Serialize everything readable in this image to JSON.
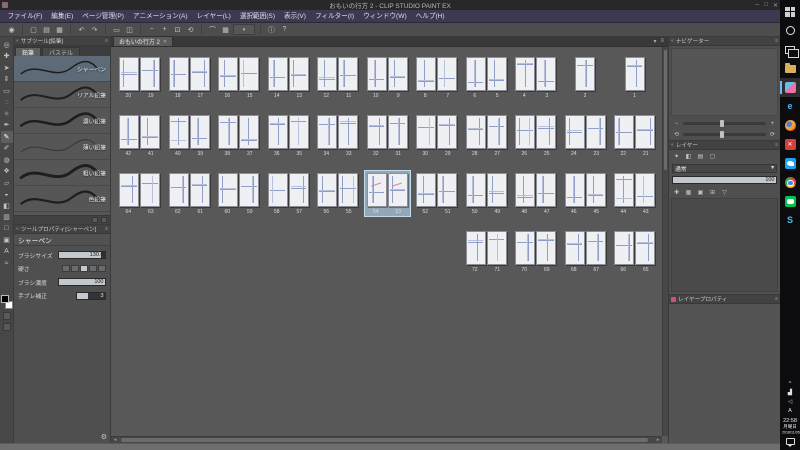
{
  "window": {
    "title": "おもいの行方 2 - CLIP STUDIO PAINT EX",
    "controls": [
      "─",
      "□",
      "✕"
    ]
  },
  "menu": {
    "items": [
      "ファイル(F)",
      "編集(E)",
      "ページ管理(P)",
      "アニメーション(A)",
      "レイヤー(L)",
      "選択範囲(S)",
      "表示(V)",
      "フィルター(I)",
      "ウィンドウ(W)",
      "ヘルプ(H)"
    ]
  },
  "command_bar": {
    "items": [
      {
        "name": "eye-icon",
        "glyph": "◉"
      },
      {
        "sep": true
      },
      {
        "name": "new-file-icon",
        "glyph": "▢"
      },
      {
        "name": "open-file-icon",
        "glyph": "▤"
      },
      {
        "name": "save-icon",
        "glyph": "▦"
      },
      {
        "sep": true
      },
      {
        "name": "undo-icon",
        "glyph": "↶"
      },
      {
        "name": "redo-icon",
        "glyph": "↷"
      },
      {
        "sep": true
      },
      {
        "name": "delete-icon",
        "glyph": "▭"
      },
      {
        "name": "deselect-icon",
        "glyph": "◫"
      },
      {
        "sep": true
      },
      {
        "name": "zoom-out-icon",
        "glyph": "−"
      },
      {
        "name": "zoom-in-icon",
        "glyph": "+"
      },
      {
        "name": "fit-view-icon",
        "glyph": "⊡"
      },
      {
        "name": "rotate-view-icon",
        "glyph": "⟲"
      },
      {
        "sep": true
      },
      {
        "name": "snap-ruler-icon",
        "glyph": "⌒"
      },
      {
        "name": "snap-grid-icon",
        "glyph": "▦"
      },
      {
        "name": "snap-mode-dropdown",
        "glyph": "▾",
        "wide": true
      },
      {
        "sep": true
      },
      {
        "name": "info-icon",
        "glyph": "ⓘ"
      },
      {
        "name": "help-icon",
        "glyph": "?"
      }
    ]
  },
  "tool_bar": {
    "tools": [
      {
        "name": "zoom-tool",
        "glyph": "◎"
      },
      {
        "name": "move-tool",
        "glyph": "✚"
      },
      {
        "name": "operation-tool",
        "glyph": "➤"
      },
      {
        "name": "layer-move-tool",
        "glyph": "⇕"
      },
      {
        "name": "selection-tool",
        "glyph": "▭"
      },
      {
        "name": "auto-select-tool",
        "glyph": "◌"
      },
      {
        "name": "eyedropper-tool",
        "glyph": "✧"
      },
      {
        "name": "pen-tool",
        "glyph": "✒"
      },
      {
        "name": "pencil-tool",
        "glyph": "✎",
        "selected": true
      },
      {
        "name": "brush-tool",
        "glyph": "✐"
      },
      {
        "name": "airbrush-tool",
        "glyph": "◍"
      },
      {
        "name": "decoration-tool",
        "glyph": "❖"
      },
      {
        "name": "eraser-tool",
        "glyph": "▱"
      },
      {
        "name": "blend-tool",
        "glyph": "◒"
      },
      {
        "name": "fill-tool",
        "glyph": "◧"
      },
      {
        "name": "gradient-tool",
        "glyph": "▥"
      },
      {
        "name": "figure-tool",
        "glyph": "□"
      },
      {
        "name": "frame-tool",
        "glyph": "▣"
      },
      {
        "name": "text-tool",
        "glyph": "A"
      },
      {
        "name": "correction-tool",
        "glyph": "≈"
      }
    ],
    "color_chips": {
      "foreground": "#000000",
      "background": "#ffffff"
    }
  },
  "subtool_panel": {
    "title": "サブツール[鉛筆]",
    "tabs": [
      {
        "label": "鉛筆",
        "active": true
      },
      {
        "label": "パステル",
        "active": false
      }
    ],
    "brushes": [
      {
        "name": "シャーペン",
        "selected": true,
        "w": 1.6
      },
      {
        "name": "リアル鉛筆",
        "w": 2.2
      },
      {
        "name": "濃い鉛筆",
        "w": 2.8
      },
      {
        "name": "薄い鉛筆",
        "w": 1.2,
        "opacity": 0.5
      },
      {
        "name": "粗い鉛筆",
        "w": 3.2,
        "dash": true
      },
      {
        "name": "色鉛筆",
        "w": 2.4
      }
    ]
  },
  "tool_property_panel": {
    "title": "ツールプロパティ[シャーペン]",
    "subtool_name": "シャーペン",
    "props": [
      {
        "label": "ブラシサイズ",
        "type": "slider",
        "value": "130.0",
        "fill": 92
      },
      {
        "label": "硬さ",
        "type": "steps",
        "steps": 5,
        "active": 2
      },
      {
        "label": "ブラシ濃度",
        "type": "slider",
        "value": "100",
        "fill": 100
      },
      {
        "label": "手ブレ補正",
        "type": "slider_small",
        "value": "3",
        "fill": 40
      }
    ]
  },
  "page_manager": {
    "tab_label": "おもいの行方 2",
    "rows": [
      {
        "cells": [
          {
            "col": 1,
            "nums": [
              "20",
              "19"
            ]
          },
          {
            "col": 2,
            "nums": [
              "18",
              "17"
            ]
          },
          {
            "col": 3,
            "nums": [
              "16",
              "15"
            ]
          },
          {
            "col": 4,
            "nums": [
              "14",
              "13"
            ]
          },
          {
            "col": 5,
            "nums": [
              "12",
              "11"
            ]
          },
          {
            "col": 6,
            "nums": [
              "10",
              "9"
            ]
          },
          {
            "col": 7,
            "nums": [
              "8",
              "7"
            ]
          },
          {
            "col": 8,
            "nums": [
              "6",
              "5"
            ]
          },
          {
            "col": 9,
            "nums": [
              "4",
              "3"
            ]
          },
          {
            "col": 10,
            "single": "2"
          },
          {
            "col": 11,
            "single": "1"
          }
        ]
      },
      {
        "cells": [
          {
            "col": 1,
            "nums": [
              "42",
              "41"
            ]
          },
          {
            "col": 2,
            "nums": [
              "40",
              "39"
            ]
          },
          {
            "col": 3,
            "nums": [
              "38",
              "37"
            ]
          },
          {
            "col": 4,
            "nums": [
              "36",
              "35"
            ]
          },
          {
            "col": 5,
            "nums": [
              "34",
              "33"
            ]
          },
          {
            "col": 6,
            "nums": [
              "32",
              "31"
            ]
          },
          {
            "col": 7,
            "nums": [
              "30",
              "29"
            ]
          },
          {
            "col": 8,
            "nums": [
              "28",
              "27"
            ]
          },
          {
            "col": 9,
            "nums": [
              "26",
              "25"
            ]
          },
          {
            "col": 10,
            "nums": [
              "24",
              "23"
            ]
          },
          {
            "col": 11,
            "nums": [
              "22",
              "21"
            ]
          }
        ]
      },
      {
        "cells": [
          {
            "col": 1,
            "nums": [
              "64",
              "63"
            ]
          },
          {
            "col": 2,
            "nums": [
              "62",
              "61"
            ]
          },
          {
            "col": 3,
            "nums": [
              "60",
              "59"
            ]
          },
          {
            "col": 4,
            "nums": [
              "58",
              "57"
            ]
          },
          {
            "col": 5,
            "nums": [
              "56",
              "55"
            ]
          },
          {
            "col": 6,
            "nums": [
              "54",
              "53"
            ],
            "selected": true
          },
          {
            "col": 7,
            "nums": [
              "52",
              "51"
            ]
          },
          {
            "col": 8,
            "nums": [
              "50",
              "49"
            ]
          },
          {
            "col": 9,
            "nums": [
              "48",
              "47"
            ]
          },
          {
            "col": 10,
            "nums": [
              "46",
              "45"
            ]
          },
          {
            "col": 11,
            "nums": [
              "44",
              "43"
            ]
          }
        ]
      },
      {
        "cells": [
          {
            "col": 8,
            "nums": [
              "72",
              "71"
            ]
          },
          {
            "col": 9,
            "nums": [
              "70",
              "69"
            ]
          },
          {
            "col": 10,
            "nums": [
              "68",
              "67"
            ]
          },
          {
            "col": 11,
            "nums": [
              "66",
              "65"
            ]
          }
        ]
      }
    ]
  },
  "navigator_panel": {
    "title": "ナビゲーター",
    "controls_row1": [
      {
        "name": "zoom-out-icon",
        "glyph": "−"
      },
      {
        "name": "zoom-slider",
        "kind": "slider"
      },
      {
        "name": "zoom-in-icon",
        "glyph": "+"
      }
    ],
    "controls_row2": [
      {
        "name": "rotate-left-icon",
        "glyph": "⟲"
      },
      {
        "name": "rotate-slider",
        "kind": "slider"
      },
      {
        "name": "rotate-right-icon",
        "glyph": "⟳"
      }
    ]
  },
  "layer_panel": {
    "title": "レイヤー",
    "blend_mode": "通常",
    "opacity": "100",
    "icons_top": [
      {
        "name": "layer-effect-icon",
        "glyph": "✦"
      },
      {
        "name": "layer-mask-icon",
        "glyph": "◧"
      },
      {
        "name": "layer-ruler-icon",
        "glyph": "▤"
      },
      {
        "name": "layer-palette-icon",
        "glyph": "▢"
      }
    ],
    "icons_bottom": [
      {
        "name": "new-layer-icon",
        "glyph": "✚"
      },
      {
        "name": "new-folder-icon",
        "glyph": "▦"
      },
      {
        "name": "duplicate-layer-icon",
        "glyph": "▣"
      },
      {
        "name": "merge-layer-icon",
        "glyph": "⊞"
      },
      {
        "name": "delete-layer-icon",
        "glyph": "▽"
      }
    ]
  },
  "layer_property_panel": {
    "title": "レイヤープロパティ"
  },
  "taskbar": {
    "items": [
      {
        "name": "start-button",
        "kind": "squares"
      },
      {
        "name": "cortana-button",
        "kind": "ring"
      },
      {
        "name": "task-view-button",
        "kind": "rects"
      },
      {
        "name": "file-explorer-button",
        "kind": "folder"
      },
      {
        "name": "clip-studio-paint-button",
        "kind": "clip",
        "active": true
      },
      {
        "name": "edge-button",
        "kind": "letter",
        "glyph": "e",
        "color": "#4ab8f0"
      },
      {
        "name": "firefox-button",
        "kind": "firefox"
      },
      {
        "name": "clip-studio-button",
        "kind": "square",
        "color": "#d4403a",
        "glyph": "✕"
      },
      {
        "name": "twitter-button",
        "kind": "twitter"
      },
      {
        "name": "chrome-button",
        "kind": "chrome"
      },
      {
        "name": "line-button",
        "kind": "line"
      },
      {
        "name": "skype-button",
        "kind": "letter",
        "glyph": "S",
        "color": "#55b8e8"
      }
    ],
    "tray": {
      "chevron": "^",
      "icons": [
        {
          "name": "network-icon",
          "glyph": "▟"
        },
        {
          "name": "volume-icon",
          "glyph": "◁"
        }
      ],
      "ime": "A"
    },
    "clock": {
      "time": "22:58",
      "day": "月曜日",
      "date": "2018/11/05"
    }
  }
}
